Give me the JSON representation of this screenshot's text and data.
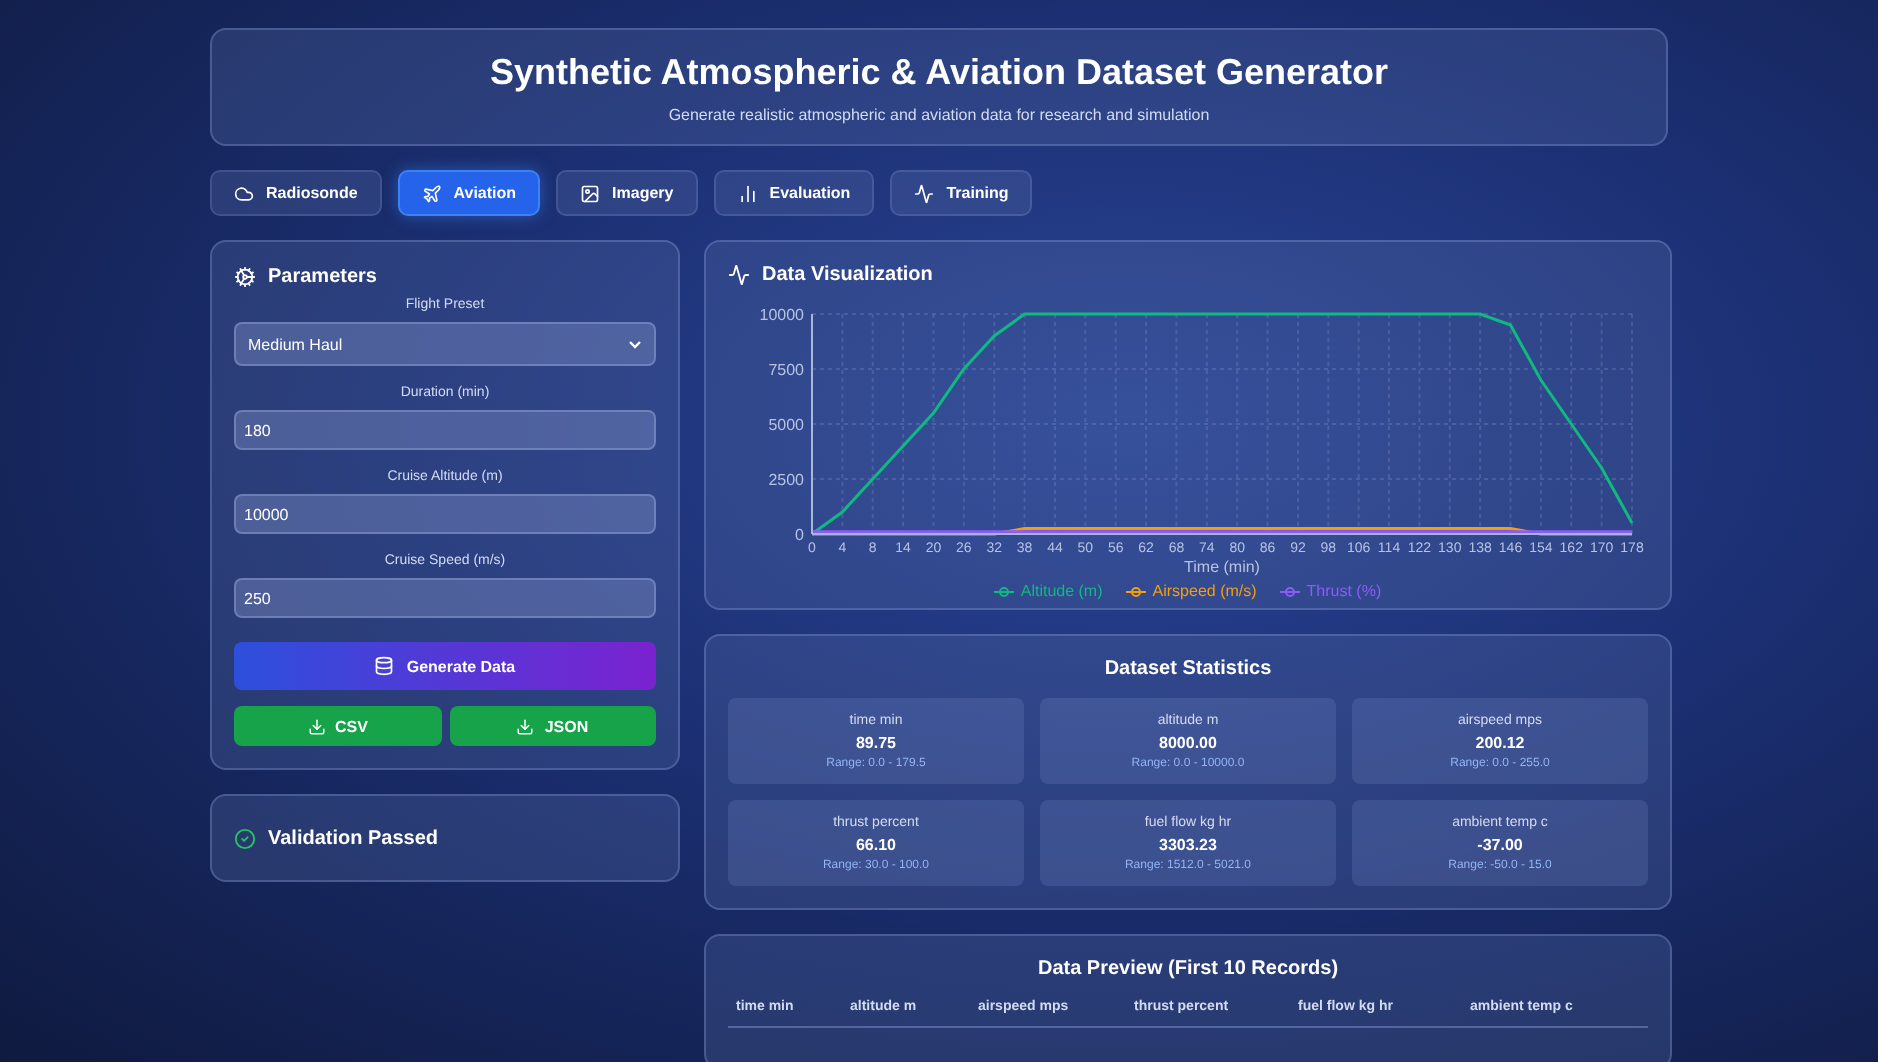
{
  "header": {
    "title": "Synthetic Atmospheric & Aviation Dataset Generator",
    "subtitle": "Generate realistic atmospheric and aviation data for research and simulation"
  },
  "tabs": [
    {
      "label": "Radiosonde",
      "selected": false
    },
    {
      "label": "Aviation",
      "selected": true
    },
    {
      "label": "Imagery",
      "selected": false
    },
    {
      "label": "Evaluation",
      "selected": false
    },
    {
      "label": "Training",
      "selected": false
    }
  ],
  "parameters": {
    "title": "Parameters",
    "fields": [
      {
        "kind": "select",
        "label": "Flight Preset",
        "value": "Medium Haul"
      },
      {
        "kind": "input",
        "label": "Duration (min)",
        "value": "180"
      },
      {
        "kind": "input",
        "label": "Cruise Altitude (m)",
        "value": "10000"
      },
      {
        "kind": "input",
        "label": "Cruise Speed (m/s)",
        "value": "250"
      }
    ],
    "generate_button": "Generate Data",
    "export_buttons": [
      "CSV",
      "JSON"
    ]
  },
  "validation": {
    "title": "Validation Passed"
  },
  "visualization": {
    "title": "Data Visualization",
    "chart_data": {
      "type": "line",
      "xlabel": "Time (min)",
      "categories": [
        "0",
        "4",
        "8",
        "14",
        "20",
        "26",
        "32",
        "38",
        "44",
        "50",
        "56",
        "62",
        "68",
        "74",
        "80",
        "86",
        "92",
        "98",
        "106",
        "114",
        "122",
        "130",
        "138",
        "146",
        "154",
        "162",
        "170",
        "178"
      ],
      "ylim": [
        0,
        10000
      ],
      "yticks": [
        0,
        2500,
        5000,
        7500,
        10000
      ],
      "grid": true,
      "legend": true,
      "series": [
        {
          "name": "Altitude (m)",
          "color": "#10b981",
          "values": [
            0,
            1000,
            2500,
            4000,
            5500,
            7500,
            9000,
            10000,
            10000,
            10000,
            10000,
            10000,
            10000,
            10000,
            10000,
            10000,
            10000,
            10000,
            10000,
            10000,
            10000,
            10000,
            10000,
            9500,
            7000,
            5000,
            3000,
            500
          ]
        },
        {
          "name": "Airspeed (m/s)",
          "color": "#f59e0b",
          "values": [
            0,
            0,
            0,
            0,
            0,
            0,
            0,
            250,
            250,
            250,
            250,
            250,
            250,
            250,
            250,
            250,
            250,
            250,
            250,
            250,
            250,
            250,
            250,
            250,
            0,
            0,
            0,
            0
          ]
        },
        {
          "name": "Thrust (%)",
          "color": "#8b5cf6",
          "values": [
            100,
            100,
            100,
            100,
            100,
            100,
            100,
            100,
            100,
            100,
            100,
            100,
            100,
            100,
            100,
            100,
            100,
            100,
            100,
            100,
            100,
            100,
            100,
            100,
            100,
            100,
            100,
            100
          ]
        }
      ]
    }
  },
  "statistics": {
    "title": "Dataset Statistics",
    "items": [
      {
        "label": "time min",
        "value": "89.75",
        "range": "Range: 0.0 - 179.5"
      },
      {
        "label": "altitude m",
        "value": "8000.00",
        "range": "Range: 0.0 - 10000.0"
      },
      {
        "label": "airspeed mps",
        "value": "200.12",
        "range": "Range: 0.0 - 255.0"
      },
      {
        "label": "thrust percent",
        "value": "66.10",
        "range": "Range: 30.0 - 100.0"
      },
      {
        "label": "fuel flow kg hr",
        "value": "3303.23",
        "range": "Range: 1512.0 - 5021.0"
      },
      {
        "label": "ambient temp c",
        "value": "-37.00",
        "range": "Range: -50.0 - 15.0"
      }
    ]
  },
  "preview": {
    "title": "Data Preview (First 10 Records)",
    "columns": [
      "time min",
      "altitude m",
      "airspeed mps",
      "thrust percent",
      "fuel flow kg hr",
      "ambient temp c"
    ]
  }
}
